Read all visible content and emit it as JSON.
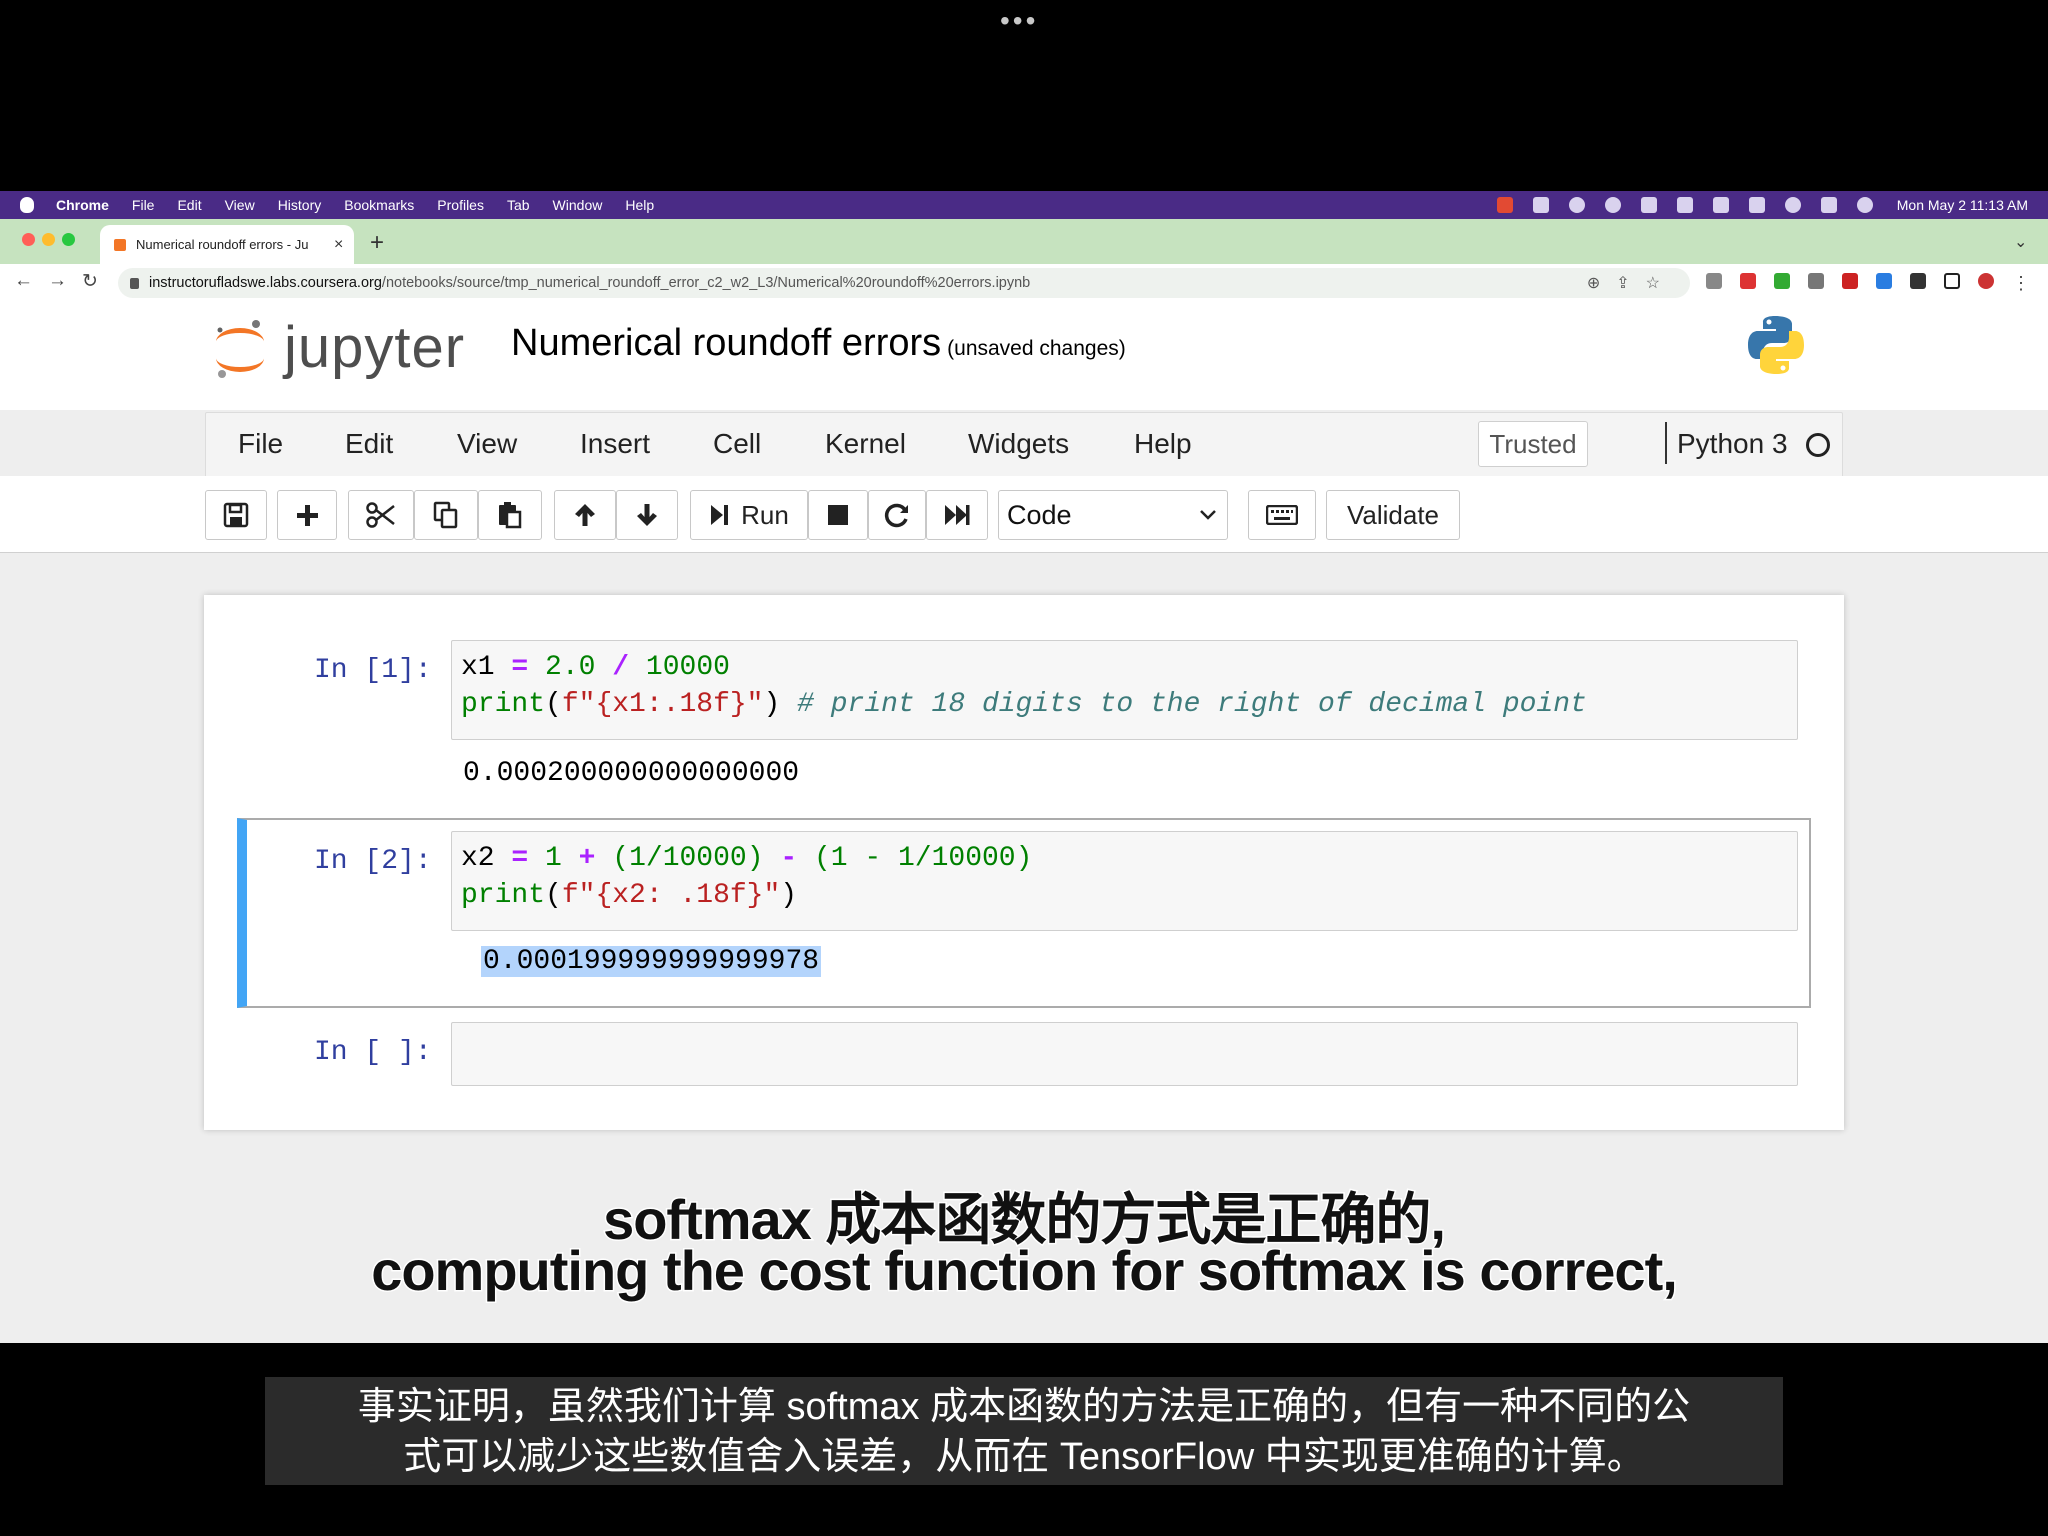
{
  "top_dots": "•••",
  "macos_menubar": {
    "items": [
      "Chrome",
      "File",
      "Edit",
      "View",
      "History",
      "Bookmarks",
      "Profiles",
      "Tab",
      "Window",
      "Help"
    ],
    "clock": "Mon May 2  11:13 AM"
  },
  "browser": {
    "tab_title": "Numerical roundoff errors - Ju",
    "tab_close": "×",
    "new_tab": "+",
    "url_host": "instructorufladswe.labs.coursera.org",
    "url_path": "/notebooks/source/tmp_numerical_roundoff_error_c2_w2_L3/Numerical%20roundoff%20errors.ipynb"
  },
  "jupyter": {
    "logo_text": "jupyter",
    "title": "Numerical roundoff errors",
    "save_status": "(unsaved changes)",
    "menu": [
      "File",
      "Edit",
      "View",
      "Insert",
      "Cell",
      "Kernel",
      "Widgets",
      "Help"
    ],
    "trusted": "Trusted",
    "kernel": "Python 3",
    "toolbar": {
      "run_label": "Run",
      "cell_type": "Code",
      "validate_label": "Validate"
    }
  },
  "cells": [
    {
      "prompt": "In [1]:",
      "line1": {
        "var": "x1",
        "eq": "=",
        "a": "2.0",
        "op": "/",
        "b": "10000"
      },
      "line2": {
        "fn": "print",
        "open": "(",
        "f": "f",
        "str": "\"{x1:.18f}\"",
        "close": ")",
        "comment": "# print 18 digits to the right of decimal point"
      },
      "output": "0.000200000000000000"
    },
    {
      "prompt": "In [2]:",
      "line1": {
        "var": "x2",
        "eq": "=",
        "n1": "1",
        "plus": "+",
        "p1": "(1/10000)",
        "minus": "-",
        "p2": "(1 - 1/10000)"
      },
      "line2": {
        "fn": "print",
        "open": "(",
        "f": "f",
        "str": "\"{x2: .18f}\"",
        "close": ")"
      },
      "output": "0.000199999999999978"
    },
    {
      "prompt": "In [ ]:"
    }
  ],
  "subtitles": {
    "line1": "softmax 成本函数的方式是正确的,",
    "line2": "computing the cost function for softmax is correct,"
  },
  "caption": {
    "line1": "事实证明，虽然我们计算 softmax 成本函数的方法是正确的，但有一种不同的公",
    "line2": "式可以减少这些数值舍入误差，从而在 TensorFlow 中实现更准确的计算。"
  },
  "colors": {
    "menubar": "#4a2b86",
    "tabbar": "#c6e3bf",
    "cell_selected": "#42a5f5",
    "prompt": "#303f9f",
    "selection": "#b3d4fc"
  }
}
